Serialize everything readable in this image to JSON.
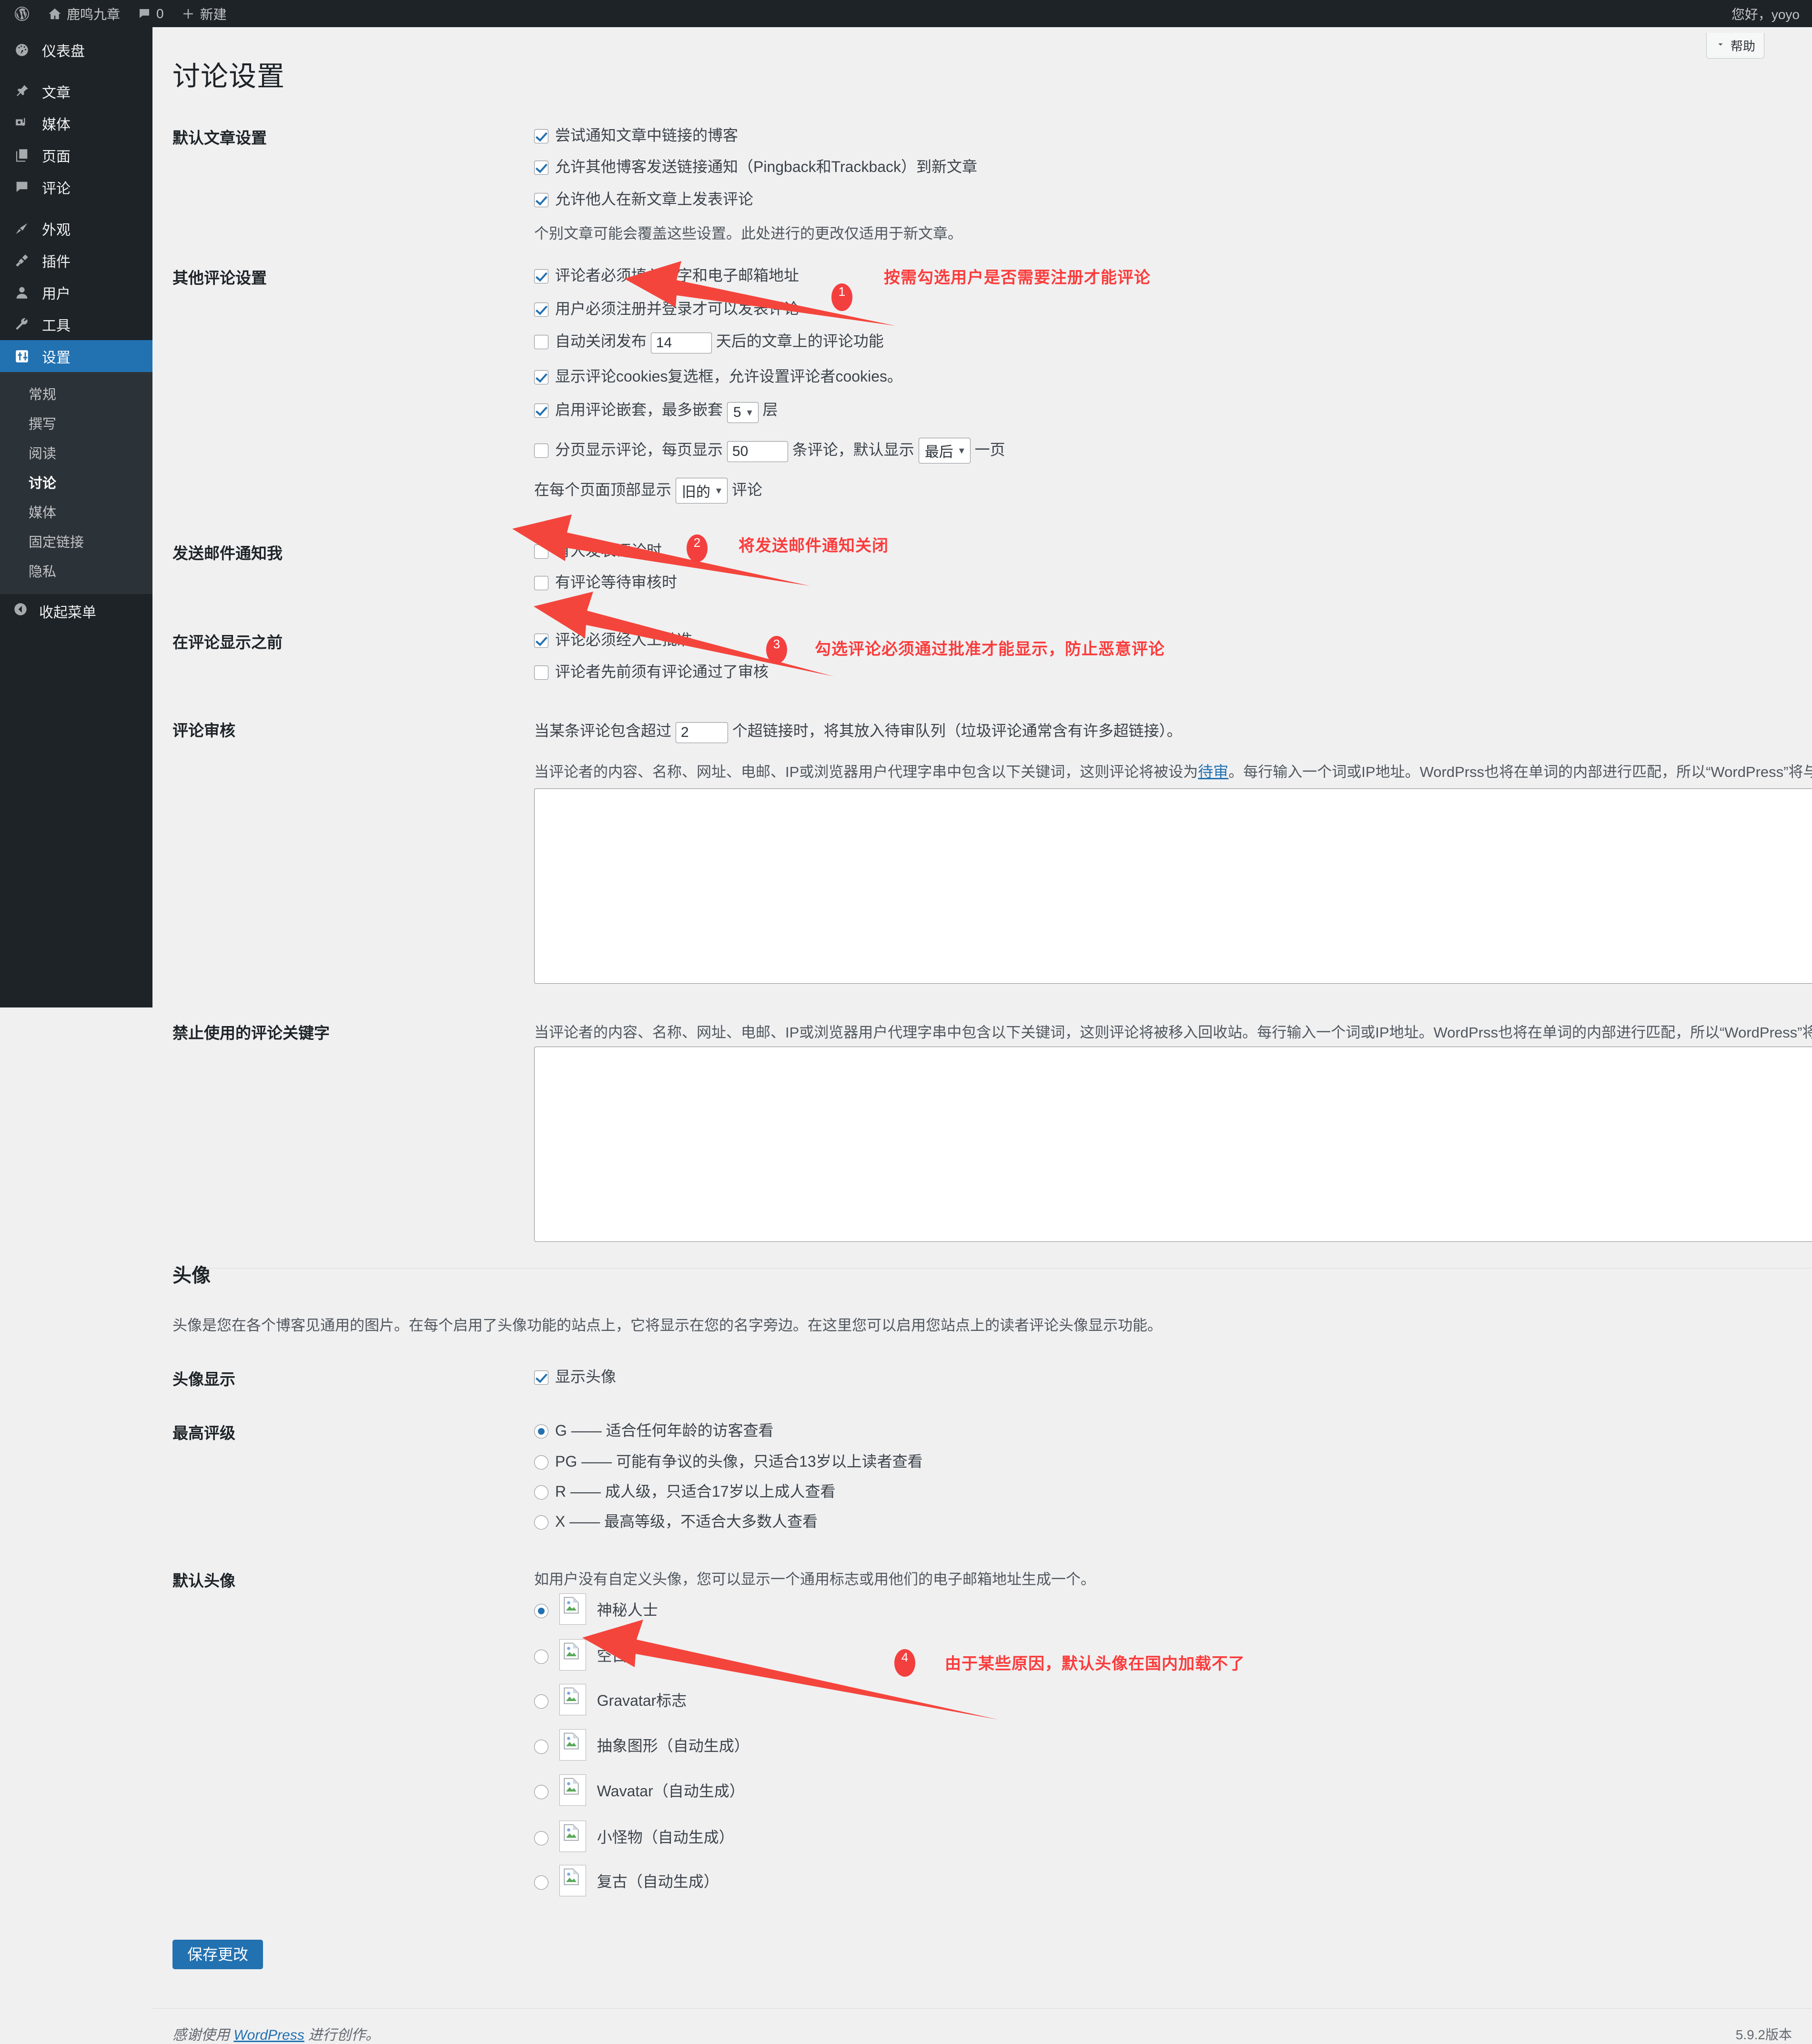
{
  "adminbar": {
    "logo_icon": "wordpress-logo-icon",
    "site_name": "鹿鸣九章",
    "site_icon": "home-icon",
    "comments_icon": "comment-bubble-icon",
    "comments_count": "0",
    "new_icon": "plus-icon",
    "new_label": "新建",
    "greeting": "您好，yoyo"
  },
  "sidebar": {
    "items": [
      {
        "label": "仪表盘",
        "icon": "dashboard-icon"
      },
      {
        "label": "文章",
        "icon": "pin-icon"
      },
      {
        "label": "媒体",
        "icon": "media-icon"
      },
      {
        "label": "页面",
        "icon": "page-icon"
      },
      {
        "label": "评论",
        "icon": "comment-bubble-icon"
      },
      {
        "label": "外观",
        "icon": "paintbrush-icon"
      },
      {
        "label": "插件",
        "icon": "plug-icon"
      },
      {
        "label": "用户",
        "icon": "user-icon"
      },
      {
        "label": "工具",
        "icon": "wrench-icon"
      },
      {
        "label": "设置",
        "icon": "settings-sliders-icon"
      }
    ],
    "submenu": [
      {
        "label": "常规"
      },
      {
        "label": "撰写"
      },
      {
        "label": "阅读"
      },
      {
        "label": "讨论"
      },
      {
        "label": "媒体"
      },
      {
        "label": "固定链接"
      },
      {
        "label": "隐私"
      }
    ],
    "collapse": {
      "label": "收起菜单",
      "icon": "collapse-arrow-icon"
    }
  },
  "help_tab": {
    "label": "帮助",
    "icon": "help-chevron-icon"
  },
  "page": {
    "title": "讨论设置"
  },
  "default_post": {
    "label": "默认文章设置",
    "options": [
      {
        "label": "尝试通知文章中链接的博客",
        "checked": true
      },
      {
        "label": "允许其他博客发送链接通知（Pingback和Trackback）到新文章",
        "checked": true
      },
      {
        "label": "允许他人在新文章上发表评论",
        "checked": true
      }
    ],
    "note": "个别文章可能会覆盖这些设置。此处进行的更改仅适用于新文章。"
  },
  "other_comment": {
    "label": "其他评论设置",
    "opt1": {
      "label": "评论者必须填入名字和电子邮箱地址",
      "checked": true
    },
    "opt2": {
      "label": "用户必须注册并登录才可以发表评论",
      "checked": true
    },
    "opt3": {
      "checked": false,
      "prefix": "自动关闭发布",
      "value": "14",
      "suffix": "天后的文章上的评论功能"
    },
    "opt4": {
      "label": "显示评论cookies复选框，允许设置评论者cookies。",
      "checked": true
    },
    "opt5": {
      "checked": true,
      "prefix": "启用评论嵌套，最多嵌套",
      "value": "5",
      "suffix": "层"
    },
    "opt6": {
      "checked": false,
      "prefix": "分页显示评论，每页显示",
      "value": "50",
      "mid": "条评论，默认显示",
      "value2": "最后",
      "suffix": "一页"
    },
    "opt7": {
      "prefix": "在每个页面顶部显示",
      "value": "旧的",
      "suffix": "评论"
    }
  },
  "email_notify": {
    "label": "发送邮件通知我",
    "options": [
      {
        "label": "有人发表评论时",
        "checked": false
      },
      {
        "label": "有评论等待审核时",
        "checked": false
      }
    ]
  },
  "before_display": {
    "label": "在评论显示之前",
    "options": [
      {
        "label": "评论必须经人工批准",
        "checked": true
      },
      {
        "label": "评论者先前须有评论通过了审核",
        "checked": false
      }
    ]
  },
  "moderation": {
    "label": "评论审核",
    "line_prefix": "当某条评论包含超过",
    "value": "2",
    "line_suffix": "个超链接时，将其放入待审队列（垃圾评论通常含有许多超链接）。",
    "desc_part1": "当评论者的内容、名称、网址、电邮、IP或浏览器用户代理字串中包含以下关键词，这则评论将被设为",
    "desc_link": "待审",
    "desc_part2": "。每行输入一个词或IP地址。WordPrss也将在单词的内部进行匹配，所以“WordPress”将与关键词“press”相匹配。",
    "textarea_value": ""
  },
  "blacklist": {
    "label": "禁止使用的评论关键字",
    "desc": "当评论者的内容、名称、网址、电邮、IP或浏览器用户代理字串中包含以下关键词，这则评论将被移入回收站。每行输入一个词或IP地址。WordPrss也将在单词的内部进行匹配，所以“WordPress”将与关键词“press”相匹配。",
    "textarea_value": ""
  },
  "avatar": {
    "section_title": "头像",
    "section_desc": "头像是您在各个博客见通用的图片。在每个启用了头像功能的站点上，它将显示在您的名字旁边。在这里您可以启用您站点上的读者评论头像显示功能。",
    "display_label": "头像显示",
    "display_option": {
      "label": "显示头像",
      "checked": true
    },
    "rating_label": "最高评级",
    "ratings": [
      {
        "label": "G —— 适合任何年龄的访客查看",
        "checked": true
      },
      {
        "label": "PG —— 可能有争议的头像，只适合13岁以上读者查看",
        "checked": false
      },
      {
        "label": "R —— 成人级，只适合17岁以上成人查看",
        "checked": false
      },
      {
        "label": "X —— 最高等级，不适合大多数人查看",
        "checked": false
      }
    ],
    "default_label": "默认头像",
    "default_desc": "如用户没有自定义头像，您可以显示一个通用标志或用他们的电子邮箱地址生成一个。",
    "defaults": [
      {
        "label": "神秘人士",
        "checked": true,
        "icon": "broken-image-icon"
      },
      {
        "label": "空白",
        "checked": false,
        "icon": "broken-image-icon"
      },
      {
        "label": "Gravatar标志",
        "checked": false,
        "icon": "broken-image-icon"
      },
      {
        "label": "抽象图形（自动生成）",
        "checked": false,
        "icon": "broken-image-icon"
      },
      {
        "label": "Wavatar（自动生成）",
        "checked": false,
        "icon": "broken-image-icon"
      },
      {
        "label": "小怪物（自动生成）",
        "checked": false,
        "icon": "broken-image-icon"
      },
      {
        "label": "复古（自动生成）",
        "checked": false,
        "icon": "broken-image-icon"
      }
    ]
  },
  "save": {
    "label": "保存更改"
  },
  "footer": {
    "thanks_prefix": "感谢使用 ",
    "thanks_link": "WordPress",
    "thanks_suffix": " 进行创作。",
    "version": "5.9.2版本"
  },
  "annotations": [
    {
      "number": "1",
      "text": "按需勾选用户是否需要注册才能评论"
    },
    {
      "number": "2",
      "text": "将发送邮件通知关闭"
    },
    {
      "number": "3",
      "text": "勾选评论必须通过批准才能显示，防止恶意评论"
    },
    {
      "number": "4",
      "text": "由于某些原因，默认头像在国内加载不了"
    }
  ],
  "colors": {
    "accent": "#2271b1",
    "sidebar_bg": "#1d2327",
    "annotation": "#fb3b3b",
    "page_bg": "#f0f0f1"
  }
}
